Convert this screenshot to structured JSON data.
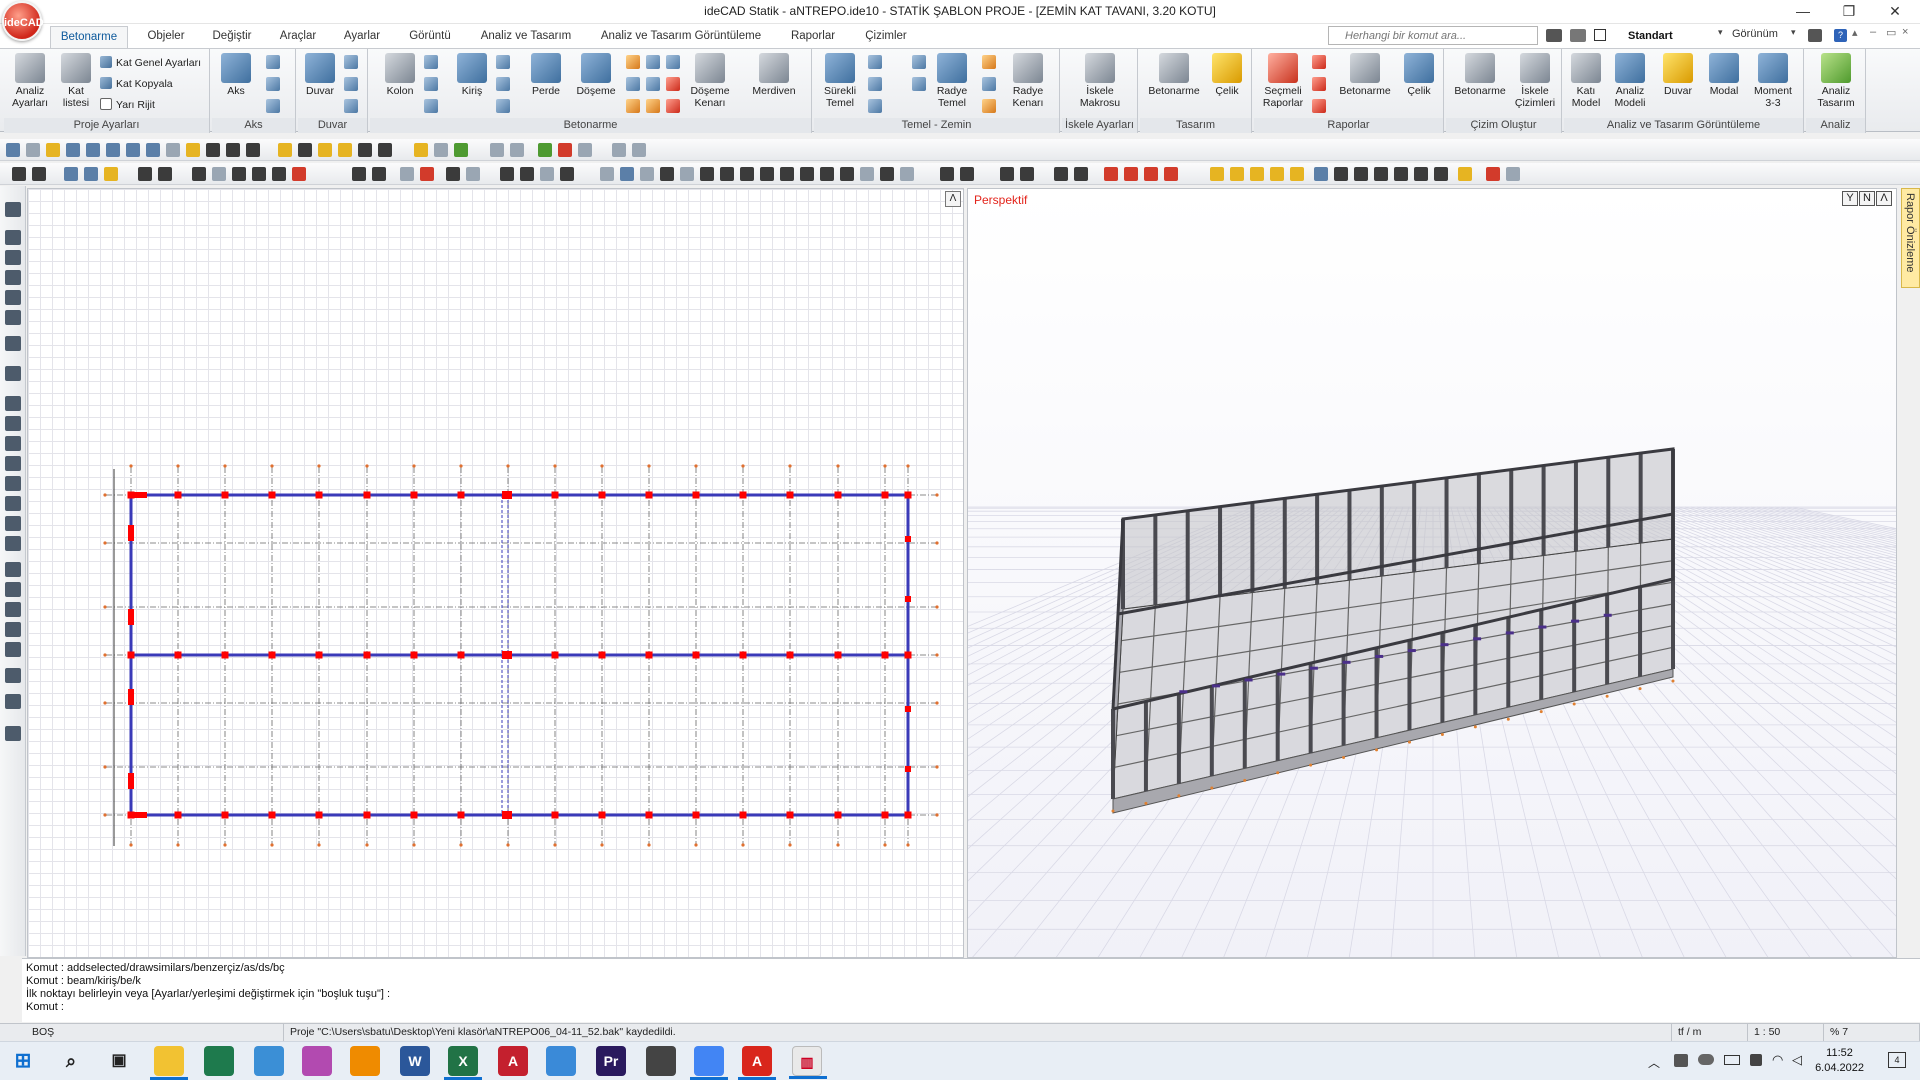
{
  "window": {
    "logo_text": "ideCAD",
    "title": "ideCAD Statik - aNTREPO.ide10 - STATİK ŞABLON PROJE - [ZEMİN KAT TAVANI,  3.20 KOTU]",
    "minimize": "—",
    "restore": "❐",
    "close": "✕"
  },
  "ribbon_tabs": [
    "Betonarme",
    "Objeler",
    "Değiştir",
    "Araçlar",
    "Ayarlar",
    "Görüntü",
    "Analiz ve Tasarım",
    "Analiz ve Tasarım Görüntüleme",
    "Raporlar",
    "Çizimler"
  ],
  "search": {
    "placeholder": "Herhangi bir komut ara..."
  },
  "view_style": {
    "label": "Standart",
    "view_menu": "Görünüm"
  },
  "ribbon": {
    "groups": {
      "proje": "Proje Ayarları",
      "aks": "Aks",
      "duvar": "Duvar",
      "betonarme": "Betonarme",
      "temel": "Temel - Zemin",
      "iskele": "İskele Ayarları",
      "tasarim": "Tasarım",
      "raporlar": "Raporlar",
      "cizim": "Çizim Oluştur",
      "analiz_gor": "Analiz ve Tasarım Görüntüleme",
      "analiz": "Analiz"
    },
    "buttons": {
      "analiz_ayarlari": "Analiz Ayarları",
      "kat_listesi": "Kat listesi",
      "kat_genel": "Kat Genel Ayarları",
      "kat_kopyala": "Kat Kopyala",
      "yari_rijit": "Yarı Rijit",
      "aks": "Aks",
      "duvar": "Duvar",
      "kolon": "Kolon",
      "kiris": "Kiriş",
      "perde": "Perde",
      "doseme": "Döşeme",
      "doseme_kenari": "Döşeme Kenarı",
      "merdiven": "Merdiven",
      "surekli_temel": "Sürekli Temel",
      "radye_temel": "Radye Temel",
      "radye_kenari": "Radye Kenarı",
      "iskele_makrosu": "İskele Makrosu",
      "tasarim_betonarme": "Betonarme",
      "tasarim_celik": "Çelik",
      "secmeli_raporlar": "Seçmeli Raporlar",
      "rapor_betonarme": "Betonarme",
      "rapor_celik": "Çelik",
      "cizim_betonarme": "Betonarme",
      "iskele_cizimleri": "İskele Çizimleri",
      "kati_model": "Katı Model",
      "analiz_modeli": "Analiz Modeli",
      "gor_duvar": "Duvar",
      "modal": "Modal",
      "moment": "Moment 3-3",
      "analiz_tasarim": "Analiz Tasarım"
    }
  },
  "views": {
    "perspective_label": "Perspektif",
    "report_tab": "Rapor Önizleme",
    "cube": [
      "Y",
      "N",
      "Λ"
    ]
  },
  "command_lines": [
    "Komut : addselected/drawsimilars/benzerçiz/as/ds/bç",
    "Komut : beam/kiriş/be/k",
    "İlk noktayı belirleyin veya [Ayarlar/yerleşimi değiştirmek için \"boşluk tuşu\"] :",
    "Komut :"
  ],
  "status": {
    "state": "BOŞ",
    "message": "Proje \"C:\\Users\\sbatu\\Desktop\\Yeni klasör\\aNTREPO06_04-11_52.bak\" kaydedildi.",
    "unit": "tf / m",
    "scale": "1 : 50",
    "zoom": "% 7"
  },
  "taskbar": {
    "time": "11:52",
    "date": "6.04.2022",
    "notifications": "4"
  },
  "colors": {
    "beam_blue": "#3a3ab8",
    "column_red": "#ff0000",
    "axis_gray": "#666666",
    "perspective_label": "#e3241b",
    "active_tab": "#0e5a9c"
  }
}
